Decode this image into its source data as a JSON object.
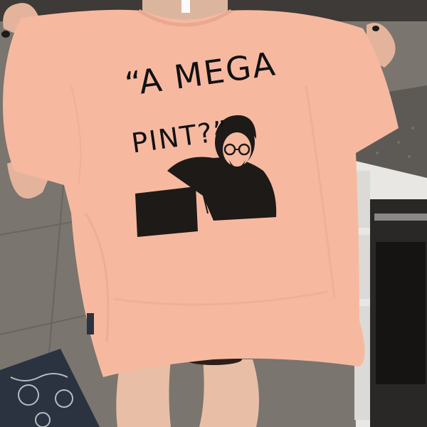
{
  "photo": {
    "subject": "t-shirt",
    "shirt_color": "#f6b9a0",
    "print_color": "#1d1a18",
    "floor_color": "#7a756e",
    "cabinet_color": "#e9e7e3",
    "countertop_color": "#5d5a55",
    "rug_color": "#2b3240"
  },
  "shirt_print": {
    "line1": "“A MEGA",
    "line2": "PINT?”"
  }
}
